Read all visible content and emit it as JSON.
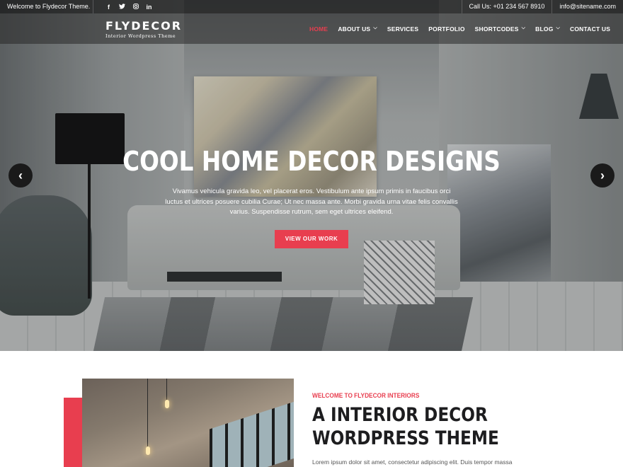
{
  "topbar": {
    "welcome": "Welcome to Flydecor Theme.",
    "social": [
      {
        "icon": "facebook-icon",
        "glyph": "f"
      },
      {
        "icon": "twitter-icon",
        "glyph": "t"
      },
      {
        "icon": "instagram-icon",
        "glyph": "◎"
      },
      {
        "icon": "linkedin-icon",
        "glyph": "in"
      }
    ],
    "phone": "Call Us: +01 234 567 8910",
    "email": "info@sitename.com"
  },
  "logo": {
    "name": "FLYDECOR",
    "tagline": "Interior Wordpress Theme"
  },
  "nav": {
    "items": [
      {
        "label": "HOME",
        "active": true,
        "dropdown": false
      },
      {
        "label": "ABOUT US",
        "active": false,
        "dropdown": true
      },
      {
        "label": "SERVICES",
        "active": false,
        "dropdown": false
      },
      {
        "label": "PORTFOLIO",
        "active": false,
        "dropdown": false
      },
      {
        "label": "SHORTCODES",
        "active": false,
        "dropdown": true
      },
      {
        "label": "BLOG",
        "active": false,
        "dropdown": true
      },
      {
        "label": "CONTACT US",
        "active": false,
        "dropdown": false
      }
    ]
  },
  "hero": {
    "title": "COOL HOME DECOR DESIGNS",
    "text": "Vivamus vehicula gravida leo, vel placerat eros. Vestibulum ante ipsum primis in faucibus orci luctus et ultrices posuere cubilia Curae; Ut nec massa ante. Morbi gravida urna vitae felis convallis varius. Suspendisse rutrum, sem eget ultrices eleifend.",
    "button": "VIEW OUR WORK",
    "prev_icon": "chevron-left-icon",
    "next_icon": "chevron-right-icon"
  },
  "about": {
    "kicker": "WELCOME TO FLYDECOR INTERIORS",
    "title_line1": "A INTERIOR DECOR",
    "title_line2": "WORDPRESS THEME",
    "text": "Lorem ipsum dolor sit amet, consectetur adipiscing elit. Duis tempor massa"
  },
  "colors": {
    "accent": "#e83e4f",
    "dark": "#1d1d1f"
  }
}
